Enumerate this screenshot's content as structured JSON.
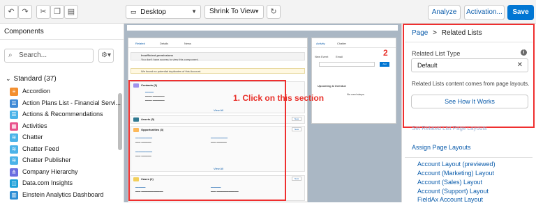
{
  "toolbar": {
    "undo_icon": "undo-icon",
    "redo_icon": "redo-icon",
    "cut_icon": "cut-icon",
    "copy_icon": "copy-icon",
    "paste_icon": "paste-icon",
    "device": "Desktop",
    "view": "Shrink To View",
    "analyze": "Analyze",
    "activation": "Activation...",
    "save": "Save"
  },
  "components": {
    "title": "Components",
    "search_placeholder": "Search...",
    "group": "Standard (37)",
    "items": [
      {
        "label": "Accordion",
        "color": "#f38f2f",
        "icon": "accordion-icon"
      },
      {
        "label": "Action Plans List - Financial Servi...",
        "color": "#3f8ad6",
        "icon": "action-plans-icon"
      },
      {
        "label": "Actions & Recommendations",
        "color": "#4bb3e8",
        "icon": "actions-icon"
      },
      {
        "label": "Activities",
        "color": "#e8508b",
        "icon": "activities-icon"
      },
      {
        "label": "Chatter",
        "color": "#4bb3e8",
        "icon": "chatter-icon"
      },
      {
        "label": "Chatter Feed",
        "color": "#4bb3e8",
        "icon": "chatter-feed-icon"
      },
      {
        "label": "Chatter Publisher",
        "color": "#4bb3e8",
        "icon": "chatter-publisher-icon"
      },
      {
        "label": "Company Hierarchy",
        "color": "#6b6ee0",
        "icon": "hierarchy-icon"
      },
      {
        "label": "Data.com Insights",
        "color": "#1b9fd8",
        "icon": "insights-icon"
      },
      {
        "label": "Einstein Analytics Dashboard",
        "color": "#2a8cd4",
        "icon": "analytics-icon"
      }
    ]
  },
  "canvas": {
    "tabs": [
      "Related",
      "Details",
      "News"
    ],
    "side_tabs": [
      "Activity",
      "Chatter"
    ],
    "notice_title": "Insufficient permissions",
    "notice_body": "You don't have access to view this component.",
    "duplicates": "We found no potential duplicates of this Account.",
    "sections": [
      {
        "title": "Contacts (1)",
        "color": "#a094ed"
      },
      {
        "title": "Assets (0)",
        "color": "#317a92"
      },
      {
        "title": "Opportunities (3)",
        "color": "#fcb95b"
      },
      {
        "title": "Cases (2)",
        "color": "#f2cf5b"
      }
    ],
    "view_all": "View All",
    "new": "New",
    "side_new_event": "New Event",
    "side_email": "Email",
    "side_upcoming": "Upcoming & Overdue",
    "side_no_steps": "No next steps.",
    "side_add": "Add"
  },
  "annotations": {
    "click_label": "1. Click on this section",
    "number_two": "2"
  },
  "properties": {
    "breadcrumb_parent": "Page",
    "breadcrumb_sep": ">",
    "breadcrumb_current": "Related Lists",
    "type_label": "Related List Type",
    "type_value": "Default",
    "note": "Related Lists content comes from page layouts.",
    "how_button": "See How It Works",
    "faded_link": "Set Related List Page Layouts",
    "assign_link": "Assign Page Layouts",
    "layouts": [
      "Account Layout (previewed)",
      "Account (Marketing) Layout",
      "Account (Sales) Layout",
      "Account (Support) Layout",
      "FieldAx Account Layout"
    ]
  }
}
